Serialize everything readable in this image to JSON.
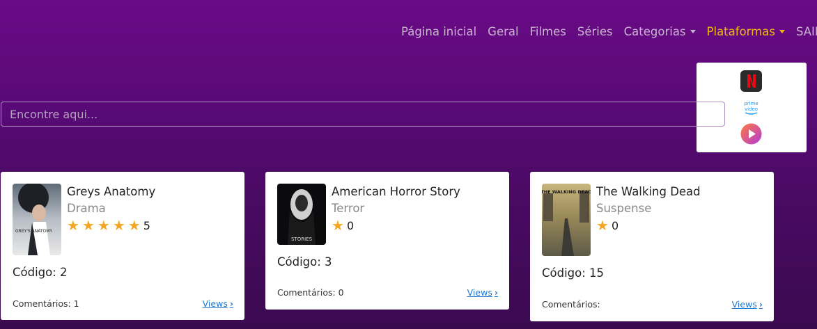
{
  "nav": {
    "items": [
      "Página inicial",
      "Geral",
      "Filmes",
      "Séries"
    ],
    "categorias": "Categorias",
    "plataformas": "Plataformas",
    "sair": "SAIR"
  },
  "dropdown": {
    "items": [
      "netflix-icon",
      "prime-video-icon",
      "play-icon"
    ],
    "prime_label": "prime video"
  },
  "search": {
    "placeholder": "Encontre aqui..."
  },
  "cards": [
    {
      "title": "Greys Anatomy",
      "genre": "Drama",
      "stars": 5,
      "rating": "5",
      "code_label": "Código: 2",
      "comments_label": "Comentários: 1",
      "views": "Views",
      "thumb_text": "GREY'S ANATOMY"
    },
    {
      "title": "American Horror Story",
      "genre": "Terror",
      "stars": 1,
      "rating": "0",
      "code_label": "Código: 3",
      "comments_label": "Comentários: 0",
      "views": "Views",
      "thumb_text": "STORIES"
    },
    {
      "title": "The Walking Dead",
      "genre": "Suspense",
      "stars": 1,
      "rating": "0",
      "code_label": "Código: 15",
      "comments_label": "Comentários:",
      "views": "Views",
      "thumb_text": "THE WALKING DEAD"
    }
  ],
  "colors": {
    "accent": "#f2b90c",
    "link": "#1f78d1",
    "star": "#f5a623"
  }
}
